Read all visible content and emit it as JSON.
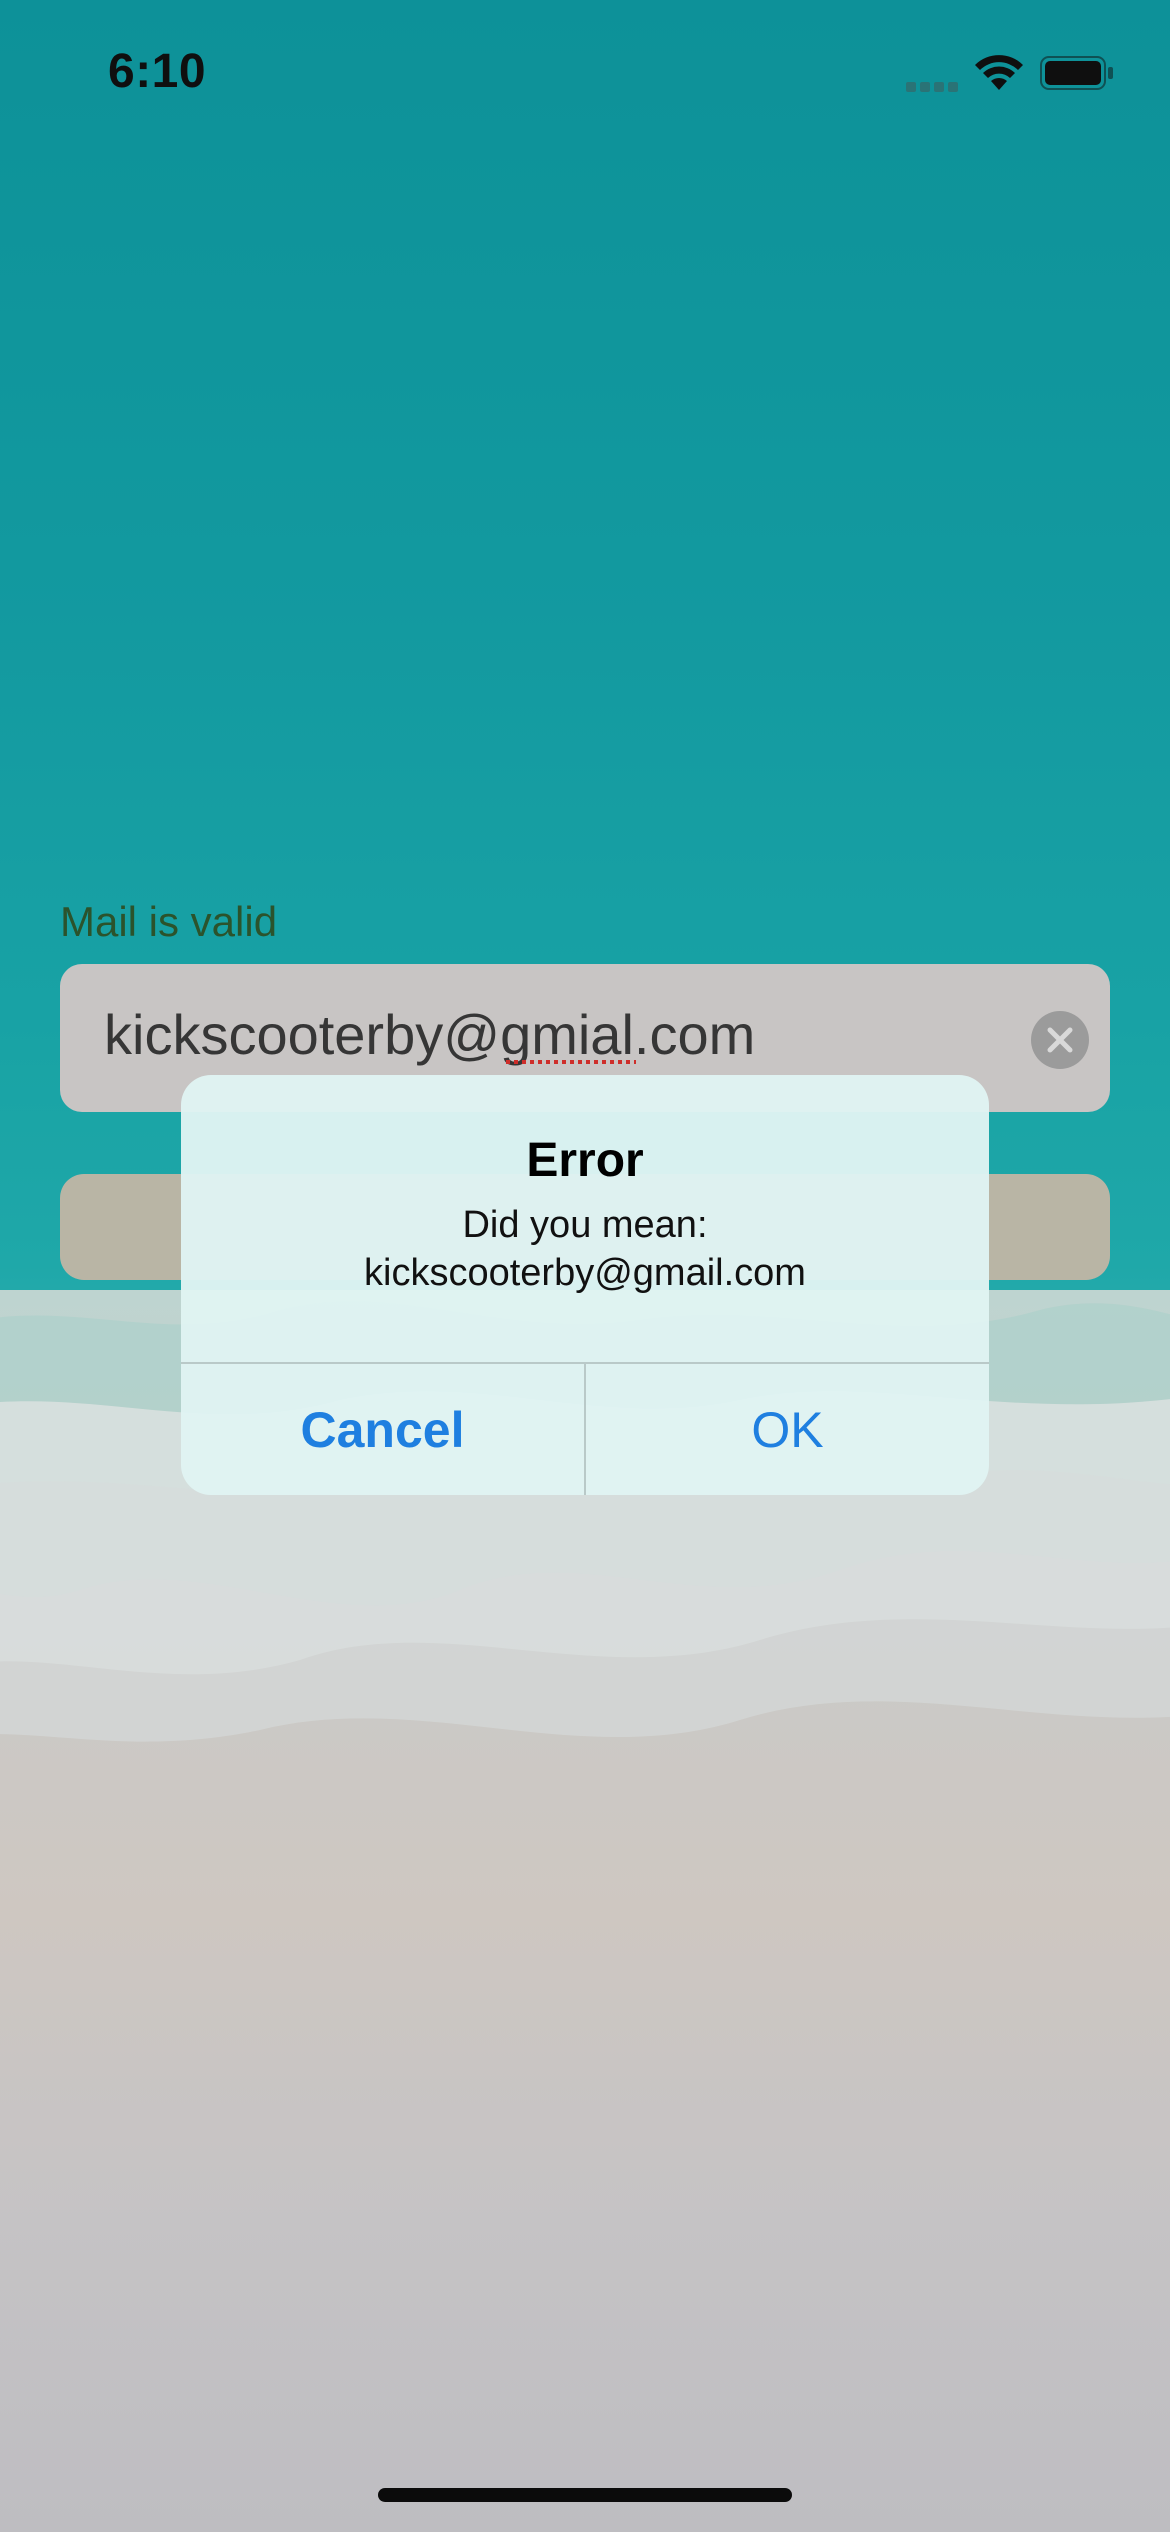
{
  "status_bar": {
    "time": "6:10",
    "icons": [
      "signal-icon",
      "wifi-icon",
      "battery-icon"
    ]
  },
  "form": {
    "validation_label": "Mail is valid",
    "email_value": "kickscooterby@gmial.com",
    "clear_icon": "clear-icon",
    "submit_button_label": ""
  },
  "alert": {
    "title": "Error",
    "message_line1": "Did you mean:",
    "message_line2": "kickscooterby@gmail.com",
    "cancel_label": "Cancel",
    "ok_label": "OK"
  },
  "colors": {
    "accent": "#1f7fe0",
    "label_green": "#2f5b30",
    "field_bg": "#d9d6d5",
    "button_bg": "#c9c5b4",
    "sea": "#1bb0b3"
  }
}
